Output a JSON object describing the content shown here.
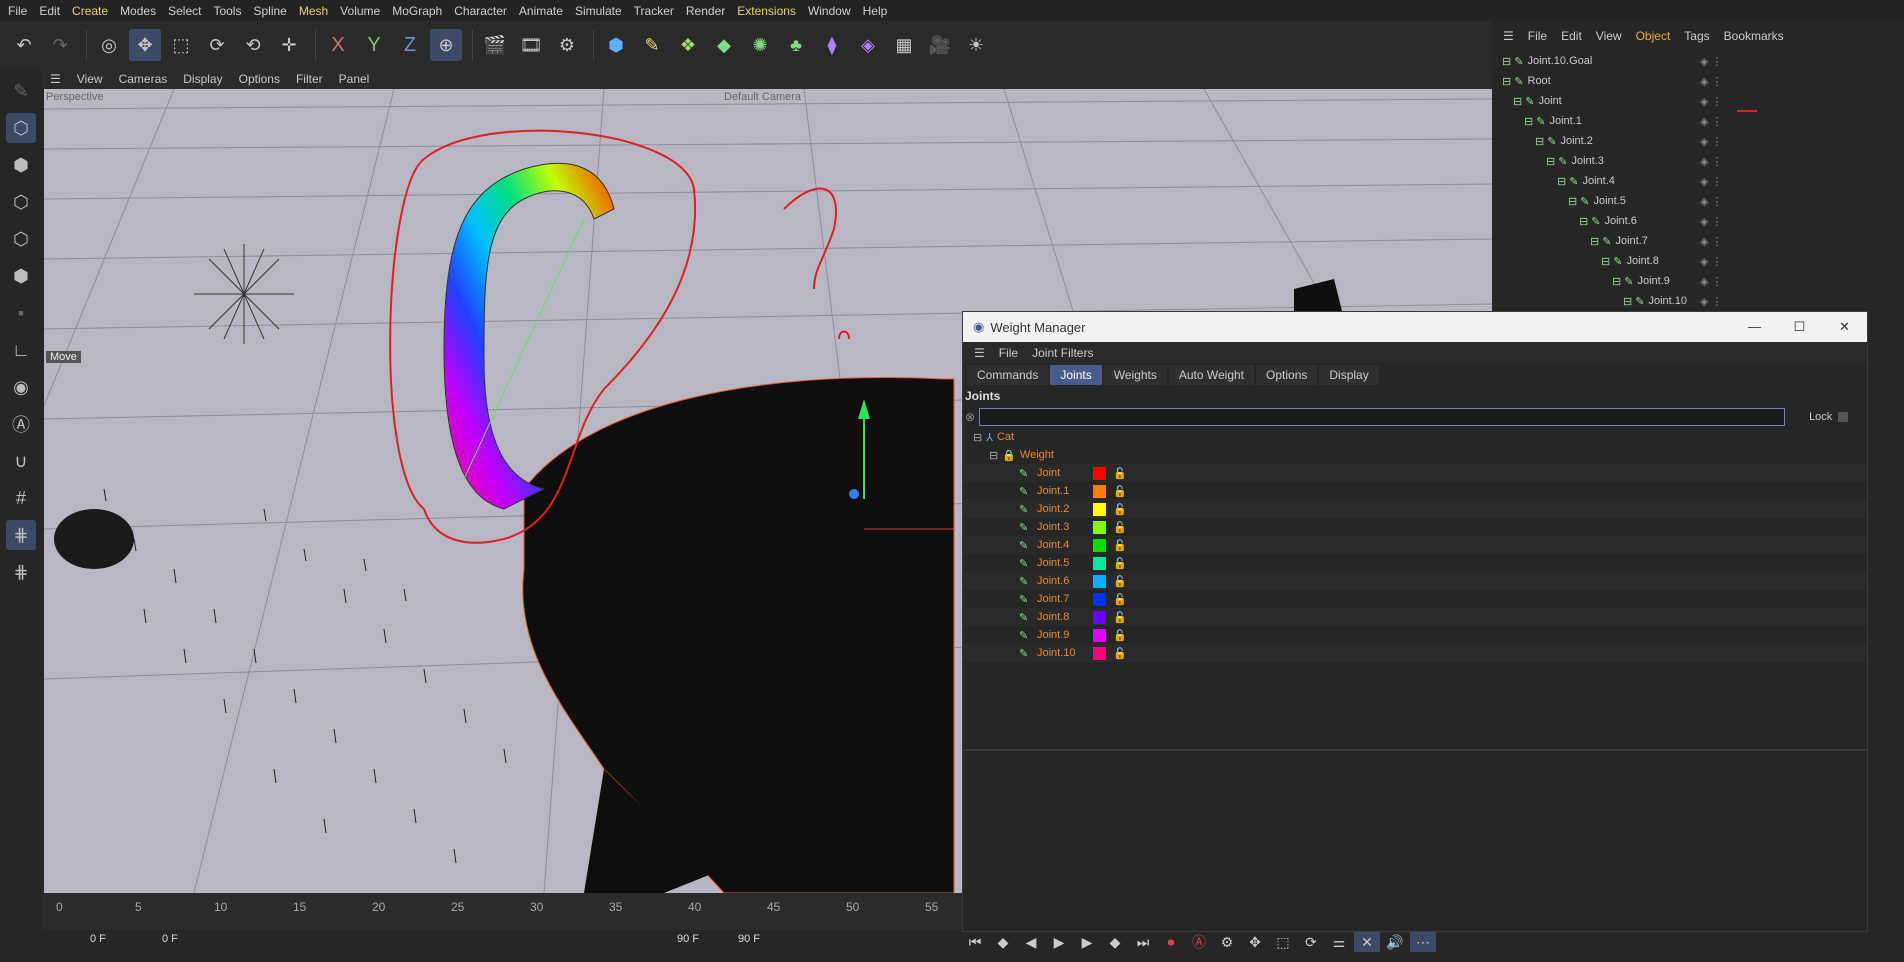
{
  "menubar": [
    "File",
    "Edit",
    "Create",
    "Modes",
    "Select",
    "Tools",
    "Spline",
    "Mesh",
    "Volume",
    "MoGraph",
    "Character",
    "Animate",
    "Simulate",
    "Tracker",
    "Render",
    "Extensions",
    "Window",
    "Help"
  ],
  "viewport": {
    "menu": [
      "View",
      "Cameras",
      "Display",
      "Options",
      "Filter",
      "Panel"
    ],
    "label_perspective": "Perspective",
    "label_camera": "Default Camera",
    "label_move": "Move"
  },
  "timeline": {
    "ticks": [
      "0",
      "5",
      "10",
      "15",
      "20",
      "25",
      "30",
      "35",
      "40",
      "45",
      "50",
      "55"
    ],
    "current_frame": "0 F",
    "start_field": "0 F",
    "end_field": "90 F",
    "max_field": "90 F"
  },
  "object_manager": {
    "menu": [
      "File",
      "Edit",
      "View",
      "Object",
      "Tags",
      "Bookmarks"
    ],
    "rows": [
      {
        "name": "Joint.10.Goal",
        "depth": 0
      },
      {
        "name": "Root",
        "depth": 0
      },
      {
        "name": "Joint",
        "depth": 1
      },
      {
        "name": "Joint.1",
        "depth": 2
      },
      {
        "name": "Joint.2",
        "depth": 3
      },
      {
        "name": "Joint.3",
        "depth": 4
      },
      {
        "name": "Joint.4",
        "depth": 5
      },
      {
        "name": "Joint.5",
        "depth": 6
      },
      {
        "name": "Joint.6",
        "depth": 7
      },
      {
        "name": "Joint.7",
        "depth": 8
      },
      {
        "name": "Joint.8",
        "depth": 9
      },
      {
        "name": "Joint.9",
        "depth": 10
      },
      {
        "name": "Joint.10",
        "depth": 11
      }
    ]
  },
  "weight_manager": {
    "title": "Weight Manager",
    "menu": [
      "File",
      "Joint Filters"
    ],
    "tabs": [
      "Commands",
      "Joints",
      "Weights",
      "Auto Weight",
      "Options",
      "Display"
    ],
    "active_tab": "Joints",
    "section_label": "Joints",
    "lock_label": "Lock",
    "tree_root": "Cat",
    "tree_tag": "Weight",
    "joints": [
      {
        "name": "Joint",
        "color": "#ff0000"
      },
      {
        "name": "Joint.1",
        "color": "#ff7f00"
      },
      {
        "name": "Joint.2",
        "color": "#ffff00"
      },
      {
        "name": "Joint.3",
        "color": "#7fff00"
      },
      {
        "name": "Joint.4",
        "color": "#00e000"
      },
      {
        "name": "Joint.5",
        "color": "#00e8a0"
      },
      {
        "name": "Joint.6",
        "color": "#00b0ff"
      },
      {
        "name": "Joint.7",
        "color": "#0030ff"
      },
      {
        "name": "Joint.8",
        "color": "#6a00ff"
      },
      {
        "name": "Joint.9",
        "color": "#e000ff"
      },
      {
        "name": "Joint.10",
        "color": "#ff0080"
      }
    ]
  },
  "colors": {
    "accent": "#4a5a8a",
    "joint_text": "#e88a30"
  }
}
